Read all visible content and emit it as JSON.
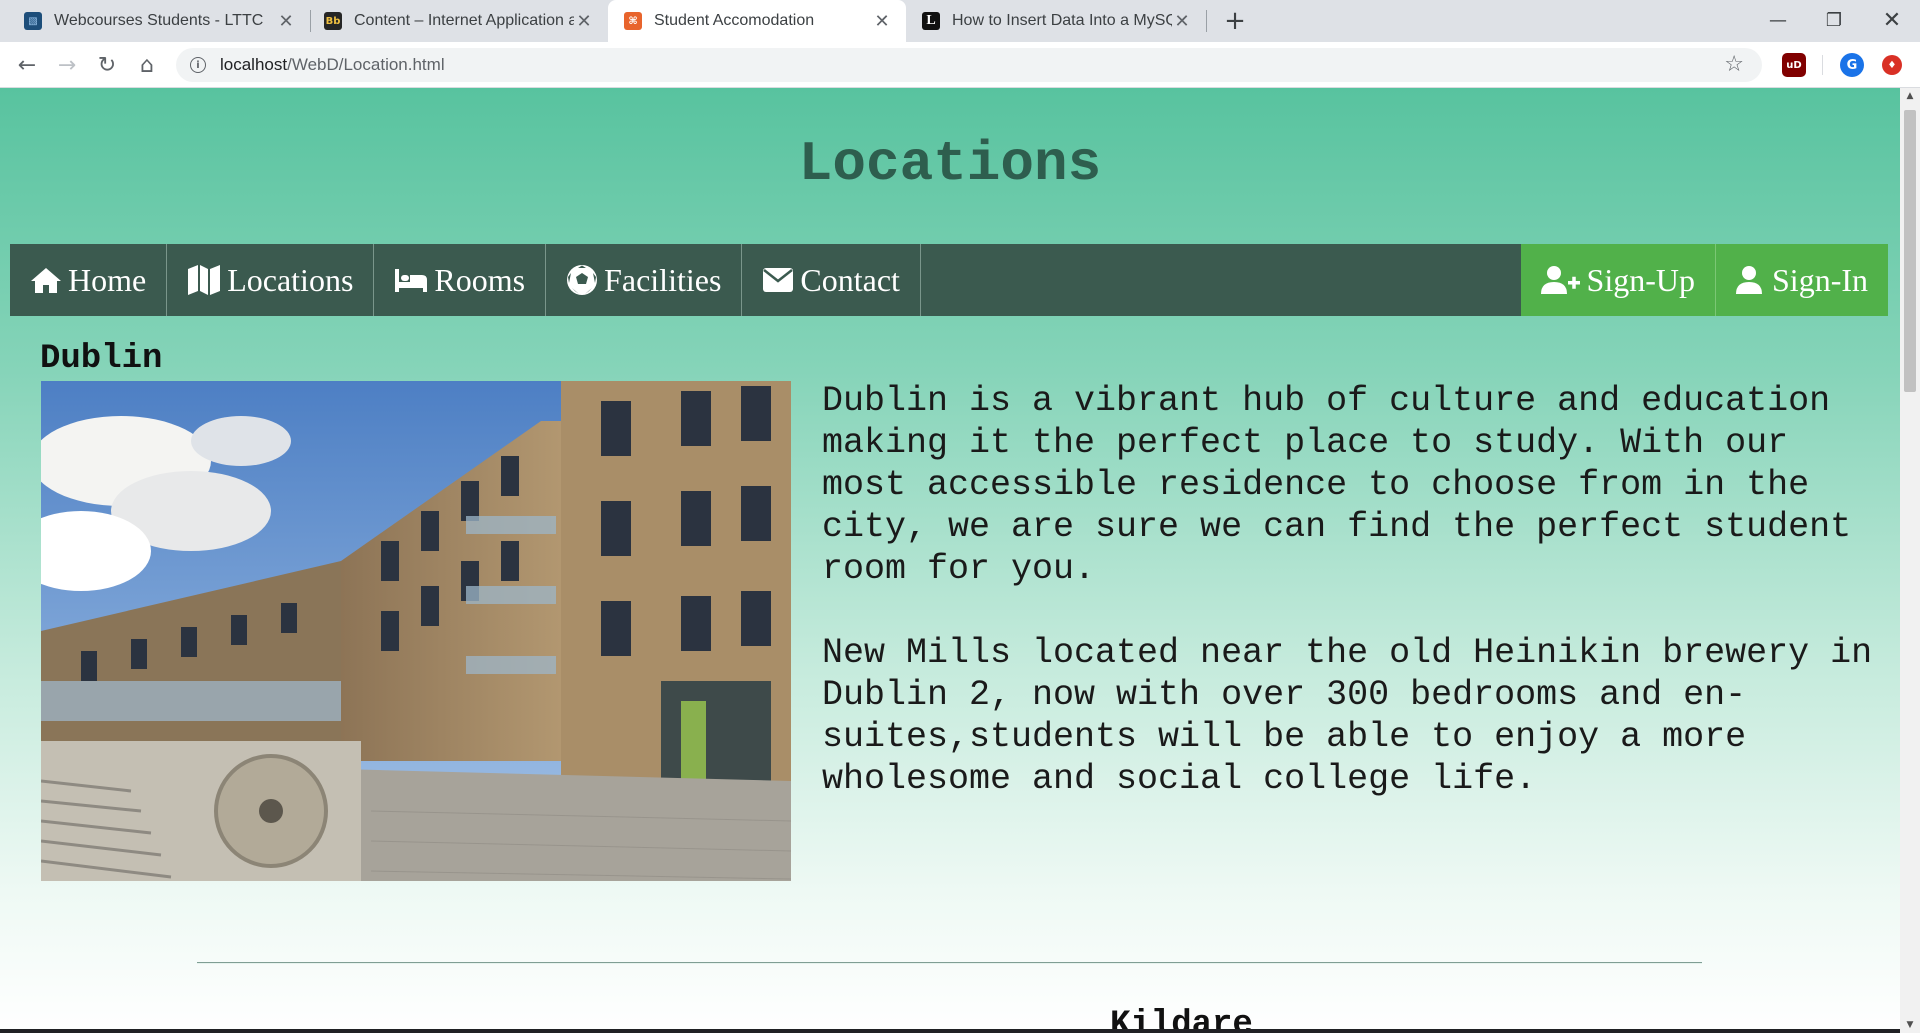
{
  "browser": {
    "tabs": [
      {
        "title": "Webcourses Students - LTTC",
        "favicon": "webcourses-icon",
        "active": false
      },
      {
        "title": "Content – Internet Application ar",
        "favicon": "blackboard-icon",
        "active": false
      },
      {
        "title": "Student Accomodation",
        "favicon": "xampp-icon",
        "active": true
      },
      {
        "title": "How to Insert Data Into a MySQL",
        "favicon": "lifewire-icon",
        "active": false
      }
    ],
    "url_host": "localhost",
    "url_path": "/WebD/Location.html",
    "extensions": [
      {
        "name": "ublock-icon",
        "label": "uD"
      },
      {
        "name": "profile-avatar",
        "label": "G"
      },
      {
        "name": "alert-extension-icon",
        "label": "♦"
      }
    ]
  },
  "page": {
    "heading": "Locations",
    "nav": {
      "left": [
        {
          "label": "Home",
          "icon": "home-icon"
        },
        {
          "label": "Locations",
          "icon": "map-icon"
        },
        {
          "label": "Rooms",
          "icon": "bed-icon"
        },
        {
          "label": "Facilities",
          "icon": "football-icon"
        },
        {
          "label": "Contact",
          "icon": "envelope-icon"
        }
      ],
      "right": [
        {
          "label": "Sign-Up",
          "icon": "user-plus-icon"
        },
        {
          "label": "Sign-In",
          "icon": "user-icon"
        }
      ]
    },
    "sections": [
      {
        "title": "Dublin",
        "paragraphs": [
          "Dublin is a vibrant hub of culture and education making it the perfect place to study. With our most accessible residence to choose from in the city, we are sure we can find the perfect student room for you.",
          "New Mills located near the old Heinikin brewery in Dublin 2, now with over 300 bedrooms and en-suites,students will be able to enjoy a more wholesome and social college life."
        ]
      },
      {
        "title": "Kildare"
      }
    ]
  },
  "colors": {
    "navbar": "#3b5a4f",
    "nav_accent": "#51b14a",
    "heading": "#2e5e4e",
    "gradient_top": "#58c39f"
  }
}
